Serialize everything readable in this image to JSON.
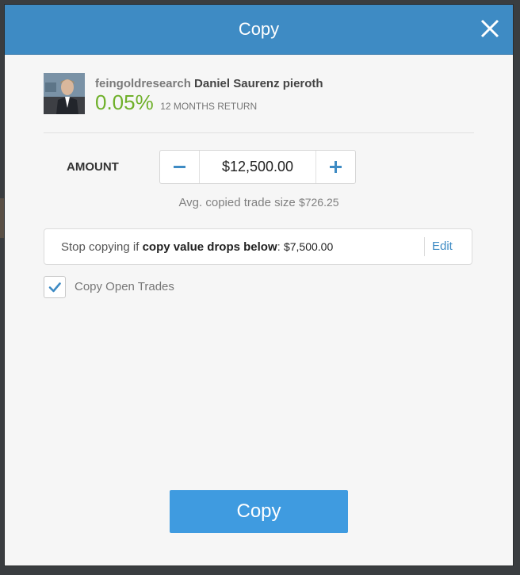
{
  "modal": {
    "title": "Copy",
    "close_icon": "close-icon"
  },
  "trader": {
    "username": "feingoldresearch",
    "full_name": "Daniel Saurenz pieroth",
    "return_value": "0.05%",
    "return_label": "12 MONTHS RETURN",
    "return_color": "#6fb02a"
  },
  "amount": {
    "label": "AMOUNT",
    "value": "$12,500.00",
    "minus_icon": "minus-icon",
    "plus_icon": "plus-icon",
    "avg_text": "Avg. copied trade size",
    "avg_value": "$726.25"
  },
  "stop_loss": {
    "prefix": "Stop copying if",
    "condition": "copy value drops below",
    "colon": ":",
    "value": "$7,500.00",
    "edit_label": "Edit"
  },
  "open_trades": {
    "label": "Copy Open Trades",
    "checked": true
  },
  "copy_button": {
    "label": "Copy"
  },
  "colors": {
    "header": "#3e8bc4",
    "accent": "#3f9be0",
    "link": "#3e8bc4"
  }
}
